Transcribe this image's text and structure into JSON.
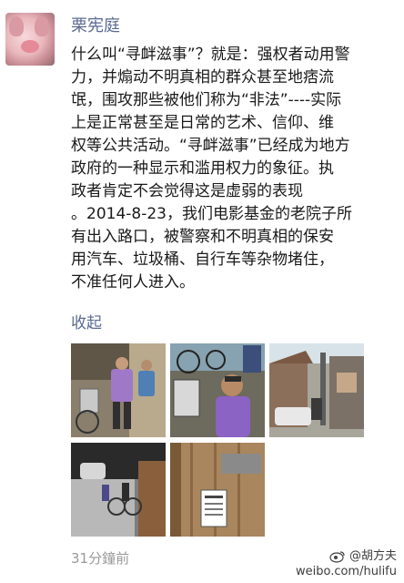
{
  "post": {
    "author_name": "栗宪庭",
    "body_lines": [
      "什么叫“寻衅滋事”？就是：强权者动用警",
      "力，并煽动不明真相的群众甚至地痞流",
      "氓，围攻那些被他们称为“非法”----实际",
      "上是正常甚至是日常的艺术、信仰、维",
      "权等公共活动。“寻衅滋事”已经成为地方",
      "政府的一种显示和滥用权力的象征。执",
      "政者肯定不会觉得这是虚弱的表现",
      "。2014-8-23，我们电影基金的老院子所",
      "有出入路口，被警察和不明真相的保安",
      "用汽车、垃圾桶、自行车等杂物堵住，",
      "不准任何人进入。"
    ],
    "collapse_label": "收起",
    "timestamp": "31分鐘前"
  },
  "photos": [
    {
      "name": "photo-1",
      "description": "people at gate with bicycles"
    },
    {
      "name": "photo-2",
      "description": "man in purple shirt with bicycles"
    },
    {
      "name": "photo-3",
      "description": "alley with vehicles"
    },
    {
      "name": "photo-4",
      "description": "surveillance view of gate"
    },
    {
      "name": "photo-5",
      "description": "wooden door with notice"
    }
  ],
  "watermark": {
    "handle": "@胡方夫",
    "url": "weibo.com/hulifu"
  },
  "colors": {
    "link_blue": "#5b6a91",
    "text": "#1a1a1a",
    "muted": "#999999"
  }
}
